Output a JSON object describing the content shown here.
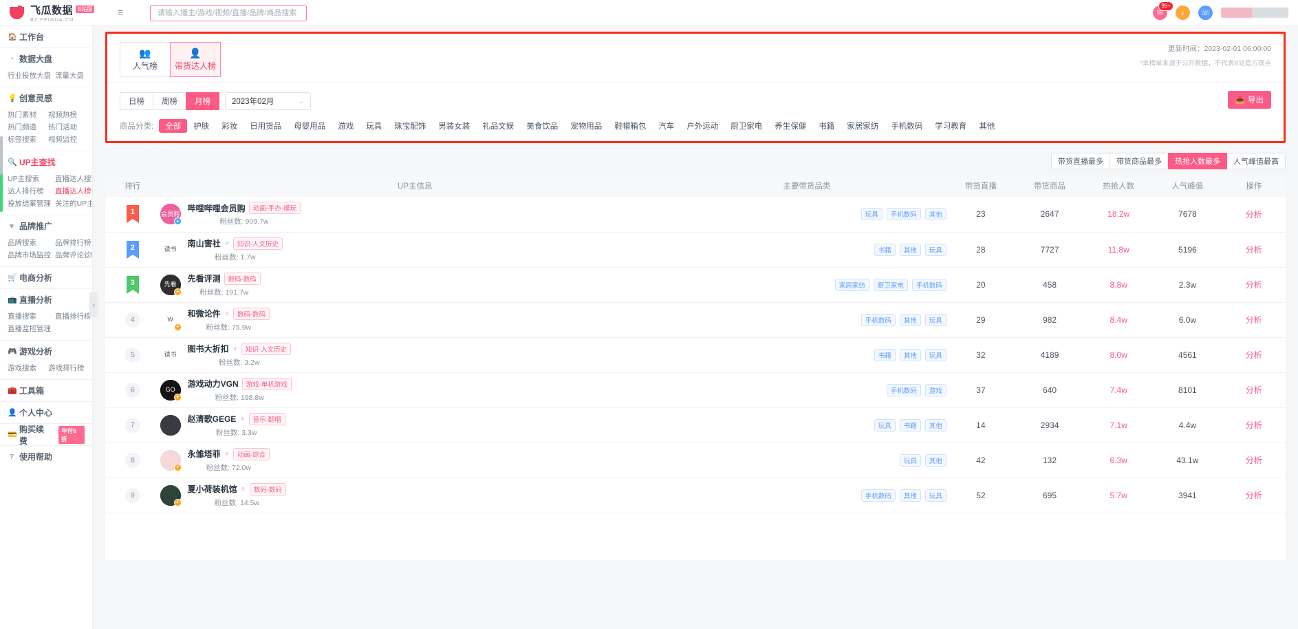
{
  "topbar": {
    "brand_name": "飞瓜数据",
    "brand_badge": "B站版",
    "brand_sub": "BZ.FEIGUA.CN",
    "menu_icon": "hamburger-icon",
    "search_placeholder": "请输入播主/游戏/视频/直播/品牌/商品搜索",
    "search_value": "",
    "mail_icon": "✉",
    "mail_badge": "99+",
    "bell_icon": "♪",
    "headset_icon": "☏"
  },
  "sidebar": {
    "groups": [
      {
        "title": "工作台",
        "icon": "🏠",
        "active": false,
        "links": []
      },
      {
        "title": "数据大盘",
        "icon": "◔",
        "active": false,
        "links": [
          "行业投放大盘",
          "流量大盘"
        ]
      },
      {
        "title": "创意灵感",
        "icon": "💡",
        "active": false,
        "links": [
          "热门素材",
          "视频热榜",
          "热门频道",
          "热门活动",
          "标签搜索",
          "视频监控"
        ]
      },
      {
        "title": "UP主查找",
        "icon": "🔍",
        "active": true,
        "links": [
          "UP主搜索",
          "直播达人搜索",
          "达人排行榜",
          "直播达人榜",
          "投放结案管理",
          "关注的UP主"
        ],
        "hot_link": "直播达人榜"
      },
      {
        "title": "品牌推广",
        "icon": "♥",
        "active": false,
        "links": [
          "品牌搜索",
          "品牌排行榜",
          "品牌市场监控",
          "品牌评论诊断"
        ]
      },
      {
        "title": "电商分析",
        "icon": "🛒",
        "active": false,
        "links": []
      },
      {
        "title": "直播分析",
        "icon": "📺",
        "active": false,
        "links": [
          "直播搜索",
          "直播排行榜",
          "直播监控管理"
        ]
      },
      {
        "title": "游戏分析",
        "icon": "🎮",
        "active": false,
        "links": [
          "游戏搜索",
          "游戏排行榜"
        ]
      },
      {
        "title": "工具箱",
        "icon": "🧰",
        "active": false,
        "links": []
      },
      {
        "title": "个人中心",
        "icon": "👤",
        "active": false,
        "links": []
      },
      {
        "title": "购买续费",
        "icon": "💳",
        "active": false,
        "links": [],
        "tag": "年付6折"
      },
      {
        "title": "使用帮助",
        "icon": "?",
        "active": false,
        "links": []
      }
    ],
    "collapse_icon": "‹"
  },
  "content": {
    "tabs": [
      {
        "label": "人气榜",
        "icon": "👥",
        "active": false
      },
      {
        "label": "带货达人榜",
        "icon": "👤",
        "active": true
      }
    ],
    "update_time": "更新时间：2023-02-01 06:00:00",
    "update_note": "*本榜单来源于公开数据，不代表B站官方观点",
    "period": [
      {
        "label": "日榜",
        "active": false
      },
      {
        "label": "周榜",
        "active": false
      },
      {
        "label": "月榜",
        "active": true
      }
    ],
    "month_value": "2023年02月",
    "month_chevron": "⌄",
    "export_label": "导出",
    "export_icon": "📥",
    "category_label": "商品分类:",
    "categories": [
      {
        "label": "全部",
        "active": true
      },
      {
        "label": "护肤",
        "active": false
      },
      {
        "label": "彩妆",
        "active": false
      },
      {
        "label": "日用货品",
        "active": false
      },
      {
        "label": "母婴用品",
        "active": false
      },
      {
        "label": "游戏",
        "active": false
      },
      {
        "label": "玩具",
        "active": false
      },
      {
        "label": "珠宝配饰",
        "active": false
      },
      {
        "label": "男装女装",
        "active": false
      },
      {
        "label": "礼品文娱",
        "active": false
      },
      {
        "label": "美食饮品",
        "active": false
      },
      {
        "label": "宠物用品",
        "active": false
      },
      {
        "label": "鞋帽箱包",
        "active": false
      },
      {
        "label": "汽车",
        "active": false
      },
      {
        "label": "户外运动",
        "active": false
      },
      {
        "label": "厨卫家电",
        "active": false
      },
      {
        "label": "养生保健",
        "active": false
      },
      {
        "label": "书籍",
        "active": false
      },
      {
        "label": "家居家纺",
        "active": false
      },
      {
        "label": "手机数码",
        "active": false
      },
      {
        "label": "学习教育",
        "active": false
      },
      {
        "label": "其他",
        "active": false
      }
    ],
    "sorts": [
      {
        "label": "带货直播最多",
        "active": false
      },
      {
        "label": "带货商品最多",
        "active": false
      },
      {
        "label": "热抢人数最多",
        "active": true
      },
      {
        "label": "人气峰值最高",
        "active": false
      }
    ],
    "table": {
      "headers": {
        "rank": "排行",
        "info": "UP主信息",
        "cats": "主要带货品类",
        "lives": "带货直播",
        "goods": "带货商品",
        "buyers": "热抢人数",
        "peak": "人气峰值",
        "op": "操作"
      },
      "op_label": "分析",
      "fans_label": "粉丝数:",
      "rows": [
        {
          "rank": "1",
          "medal": "gold",
          "name": "哔哩哔哩会员购",
          "gender": "",
          "tag": "动画-手办·模玩",
          "fans": "909.7w",
          "avatar_bg": "#f05f9b",
          "avatar_text": "会员购",
          "badge": "blue",
          "cats": [
            "玩具",
            "手机数码",
            "其他"
          ],
          "lives": "23",
          "goods": "2647",
          "buyers": "18.2w",
          "peak": "7678"
        },
        {
          "rank": "2",
          "medal": "silver",
          "name": "南山害社",
          "gender": "male",
          "tag": "知识-人文历史",
          "fans": "1.7w",
          "avatar_bg": "#ffffff",
          "avatar_text": "读书",
          "badge": "none",
          "cats": [
            "书籍",
            "其他",
            "玩具"
          ],
          "lives": "28",
          "goods": "7727",
          "buyers": "11.8w",
          "peak": "5196"
        },
        {
          "rank": "3",
          "medal": "bronze",
          "name": "先看评测",
          "gender": "",
          "tag": "数码-数码",
          "fans": "191.7w",
          "avatar_bg": "#2e2e2e",
          "avatar_text": "先看",
          "badge": "orange",
          "cats": [
            "家居家纺",
            "厨卫家电",
            "手机数码"
          ],
          "lives": "20",
          "goods": "458",
          "buyers": "8.8w",
          "peak": "2.3w"
        },
        {
          "rank": "4",
          "medal": "",
          "name": "和微论件",
          "gender": "female",
          "tag": "数码-数码",
          "fans": "75.9w",
          "avatar_bg": "#ffffff",
          "avatar_text": "W",
          "badge": "orange",
          "cats": [
            "手机数码",
            "其他",
            "玩具"
          ],
          "lives": "29",
          "goods": "982",
          "buyers": "8.4w",
          "peak": "6.0w"
        },
        {
          "rank": "5",
          "medal": "",
          "name": "图书大折扣",
          "gender": "female",
          "tag": "知识-人文历史",
          "fans": "3.2w",
          "avatar_bg": "#ffffff",
          "avatar_text": "读书",
          "badge": "none",
          "cats": [
            "书籍",
            "其他",
            "玩具"
          ],
          "lives": "32",
          "goods": "4189",
          "buyers": "8.0w",
          "peak": "4561"
        },
        {
          "rank": "6",
          "medal": "",
          "name": "游戏动力VGN",
          "gender": "",
          "tag": "游戏-单机游戏",
          "fans": "198.8w",
          "avatar_bg": "#141414",
          "avatar_text": "GO",
          "badge": "orange",
          "cats": [
            "手机数码",
            "游戏"
          ],
          "lives": "37",
          "goods": "640",
          "buyers": "7.4w",
          "peak": "8101"
        },
        {
          "rank": "7",
          "medal": "",
          "name": "赵清歌GEGE",
          "gender": "female",
          "tag": "音乐-翻唱",
          "fans": "3.3w",
          "avatar_bg": "#3a3a42",
          "avatar_text": "",
          "badge": "none",
          "cats": [
            "玩具",
            "书籍",
            "其他"
          ],
          "lives": "14",
          "goods": "2934",
          "buyers": "7.1w",
          "peak": "4.4w"
        },
        {
          "rank": "8",
          "medal": "",
          "name": "永雏塔菲",
          "gender": "female",
          "tag": "动画-综合",
          "fans": "72.0w",
          "avatar_bg": "#f6d7da",
          "avatar_text": "",
          "badge": "orange",
          "cats": [
            "玩具",
            "其他"
          ],
          "lives": "42",
          "goods": "132",
          "buyers": "6.3w",
          "peak": "43.1w"
        },
        {
          "rank": "9",
          "medal": "",
          "name": "夏小荷装机馆",
          "gender": "female",
          "tag": "数码-数码",
          "fans": "14.5w",
          "avatar_bg": "#2f4438",
          "avatar_text": "",
          "badge": "orange",
          "cats": [
            "手机数码",
            "其他",
            "玩具"
          ],
          "lives": "52",
          "goods": "695",
          "buyers": "5.7w",
          "peak": "3941"
        }
      ]
    }
  }
}
